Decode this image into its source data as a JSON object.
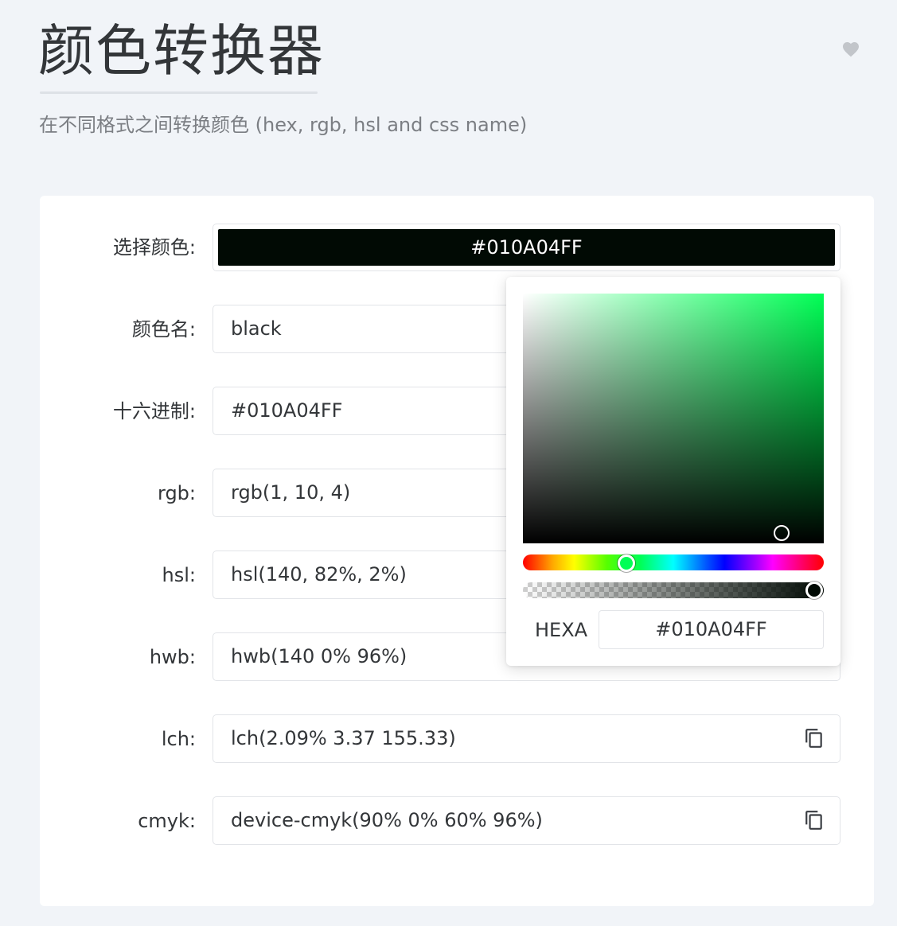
{
  "header": {
    "title": "颜色转换器",
    "subtitle": "在不同格式之间转换颜色 (hex, rgb, hsl and css name)",
    "favorite_icon": "heart-icon"
  },
  "picker_field": {
    "label": "选择颜色:",
    "value": "#010A04FF",
    "swatch_color": "#010A04"
  },
  "rows": [
    {
      "label": "颜色名:",
      "value": "black"
    },
    {
      "label": "十六进制:",
      "value": "#010A04FF"
    },
    {
      "label": "rgb:",
      "value": "rgb(1, 10, 4)"
    },
    {
      "label": "hsl:",
      "value": "hsl(140, 82%, 2%)"
    },
    {
      "label": "hwb:",
      "value": "hwb(140 0% 96%)"
    },
    {
      "label": "lch:",
      "value": "lch(2.09% 3.37 155.33)",
      "icon": "copy-icon"
    },
    {
      "label": "cmyk:",
      "value": "device-cmyk(90% 0% 60% 96%)",
      "icon": "copy-icon"
    }
  ],
  "color_popup": {
    "hue_color": "#00ff55",
    "mode_label": "HEXA",
    "hexa_value": "#010A04FF"
  },
  "colors": {
    "background": "#f1f4f8",
    "card": "#ffffff",
    "text": "#333639",
    "muted": "#7b7e83"
  }
}
